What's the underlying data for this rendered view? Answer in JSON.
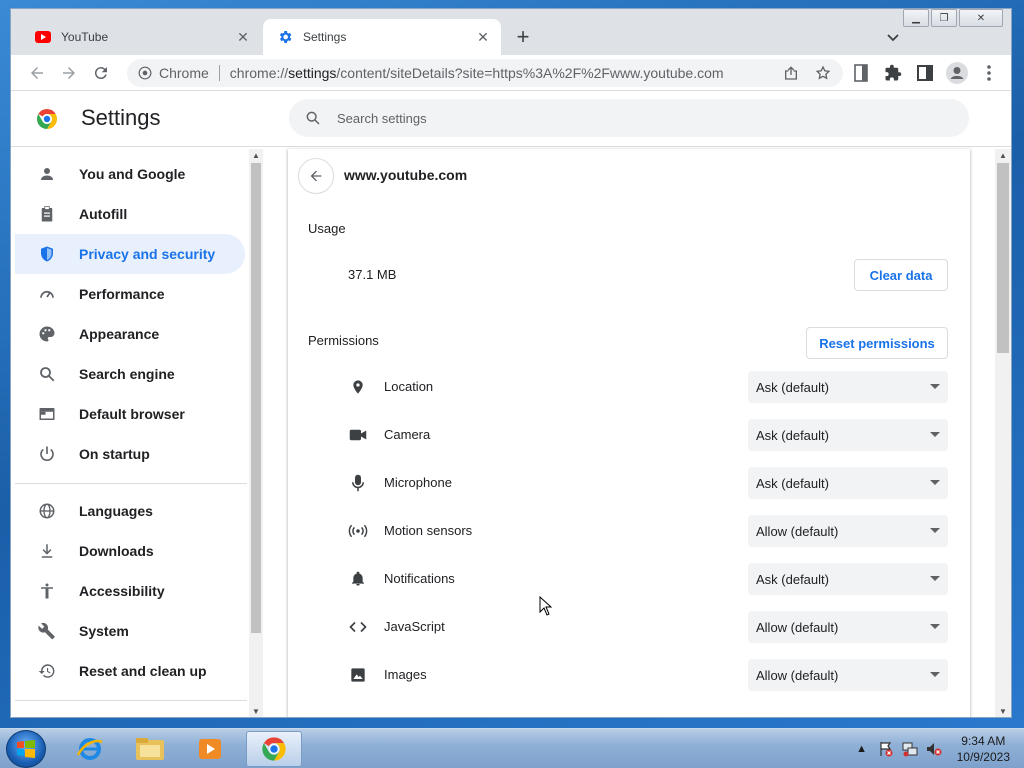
{
  "browser": {
    "tabs": [
      {
        "title": "YouTube",
        "icon": "youtube-icon"
      },
      {
        "title": "Settings",
        "icon": "settings-gear-icon"
      }
    ],
    "omnibox": {
      "site_label": "Chrome",
      "url_scheme": "chrome://",
      "url_host": "settings",
      "url_path": "/content/siteDetails?site=https%3A%2F%2Fwww.youtube.com"
    }
  },
  "settings": {
    "title": "Settings",
    "search_placeholder": "Search settings",
    "nav": [
      {
        "label": "You and Google",
        "icon": "person-icon"
      },
      {
        "label": "Autofill",
        "icon": "clipboard-icon"
      },
      {
        "label": "Privacy and security",
        "icon": "shield-icon",
        "active": true
      },
      {
        "label": "Performance",
        "icon": "speedometer-icon"
      },
      {
        "label": "Appearance",
        "icon": "palette-icon"
      },
      {
        "label": "Search engine",
        "icon": "search-icon"
      },
      {
        "label": "Default browser",
        "icon": "browser-window-icon"
      },
      {
        "label": "On startup",
        "icon": "power-icon"
      },
      {
        "label": "Languages",
        "icon": "globe-icon"
      },
      {
        "label": "Downloads",
        "icon": "download-icon"
      },
      {
        "label": "Accessibility",
        "icon": "accessibility-icon"
      },
      {
        "label": "System",
        "icon": "wrench-icon"
      },
      {
        "label": "Reset and clean up",
        "icon": "history-icon"
      }
    ],
    "site": {
      "host": "www.youtube.com",
      "usage_label": "Usage",
      "usage_value": "37.1 MB",
      "clear_data_label": "Clear data",
      "permissions_label": "Permissions",
      "reset_permissions_label": "Reset permissions",
      "permissions": [
        {
          "label": "Location",
          "value": "Ask (default)",
          "icon": "location-pin-icon"
        },
        {
          "label": "Camera",
          "value": "Ask (default)",
          "icon": "camera-icon"
        },
        {
          "label": "Microphone",
          "value": "Ask (default)",
          "icon": "microphone-icon"
        },
        {
          "label": "Motion sensors",
          "value": "Allow (default)",
          "icon": "motion-sensors-icon"
        },
        {
          "label": "Notifications",
          "value": "Ask (default)",
          "icon": "bell-icon"
        },
        {
          "label": "JavaScript",
          "value": "Allow (default)",
          "icon": "code-icon"
        },
        {
          "label": "Images",
          "value": "Allow (default)",
          "icon": "image-icon"
        }
      ]
    }
  },
  "taskbar": {
    "time": "9:34 AM",
    "date": "10/9/2023"
  },
  "colors": {
    "accent": "#1a73e8",
    "active_nav_bg": "#e8f0fe",
    "youtube_red": "#ff0000"
  }
}
